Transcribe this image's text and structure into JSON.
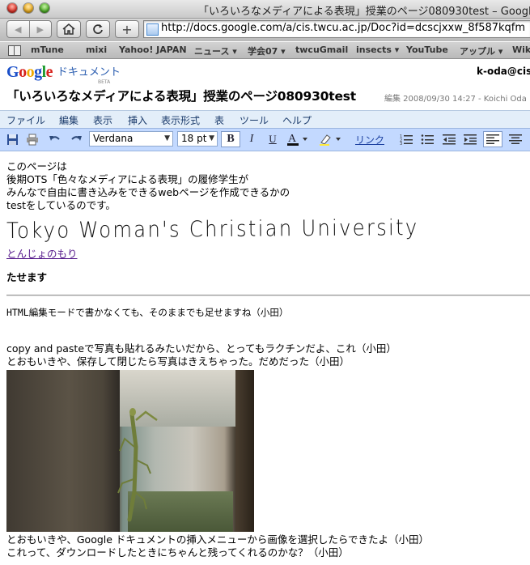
{
  "window": {
    "title": "「いろいろなメディアによる表現」授業のページ080930test – Google"
  },
  "nav": {
    "url": "http://docs.google.com/a/cis.twcu.ac.jp/Doc?id=dcscjxxw_8f587kqfm"
  },
  "bookmarks": [
    "mTune",
    "mixi",
    "Yahoo! JAPAN",
    "ニュース ▾",
    "学会07 ▾",
    "twcuGmail",
    "insects ▾",
    "YouTube",
    "アップル ▾",
    "Wik"
  ],
  "docs": {
    "logo_google": "Google",
    "logo_product": "ドキュメント",
    "logo_beta": "BETA",
    "user": "k-oda@cis",
    "doc_title": "「いろいろなメディアによる表現」授業のページ080930test",
    "edit_info": "編集 2008/09/30 14:27 - Koichi Oda"
  },
  "menu": [
    "ファイル",
    "編集",
    "表示",
    "挿入",
    "表示形式",
    "表",
    "ツール",
    "ヘルプ"
  ],
  "toolbar": {
    "font": "Verdana",
    "size": "18 pt",
    "bold": "B",
    "italic": "I",
    "underline": "U",
    "link": "リンク"
  },
  "content": {
    "intro": [
      "このページは",
      "後期OTS「色々なメディアによる表現」の履修学生が",
      "みんなで自由に書き込みをできるwebページを作成できるかの",
      "testをしているのです。"
    ],
    "handwriting": "Tokyo Woman's Christian University",
    "link": "とんじょのもり",
    "bold_line": "たせます",
    "html_note": "HTML編集モードで書かなくても、そのままでも足せますね（小田）",
    "copy_note": [
      "copy and pasteで写真も貼れるみたいだから、とってもラクチンだよ、これ（小田）",
      "とおもいきや、保存して閉じたら写真はきえちゃった。だめだった（小田）"
    ],
    "after_photo": [
      "とおもいきや、Google ドキュメントの挿入メニューから画像を選択したらできたよ（小田）",
      "これって、ダウンロードしたときにちゃんと残ってくれるのかな？（小田）"
    ]
  },
  "colors": {
    "menubar_bg": "#e3eef9",
    "toolbar_bg": "#c3d9ff",
    "link": "#551a8b"
  }
}
